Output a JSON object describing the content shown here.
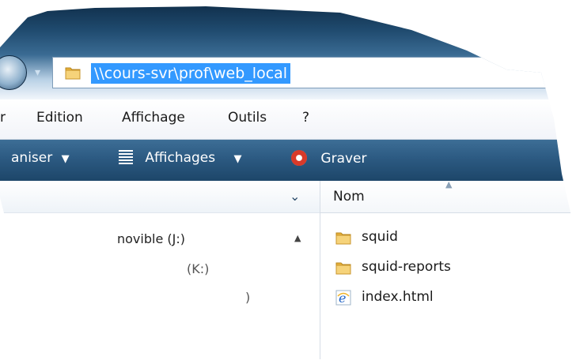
{
  "address": {
    "path": "\\\\cours-svr\\prof\\web_local"
  },
  "menu": {
    "items": [
      "r",
      "Edition",
      "Affichage",
      "Outils",
      "?"
    ]
  },
  "toolbar": {
    "organize_label": "aniser",
    "views_label": "Affichages",
    "burn_label": "Graver"
  },
  "left_pane": {
    "items": [
      "novible (J:)",
      "(K:)",
      ")"
    ]
  },
  "right_pane": {
    "column_header": "Nom",
    "files": [
      {
        "name": "squid",
        "icon": "folder-icon"
      },
      {
        "name": "squid-reports",
        "icon": "folder-icon"
      },
      {
        "name": "index.html",
        "icon": "ie-html-icon"
      }
    ]
  },
  "colors": {
    "selection": "#3399ff",
    "toolbar": "#2c5a82",
    "folder": "#f2c14e"
  }
}
